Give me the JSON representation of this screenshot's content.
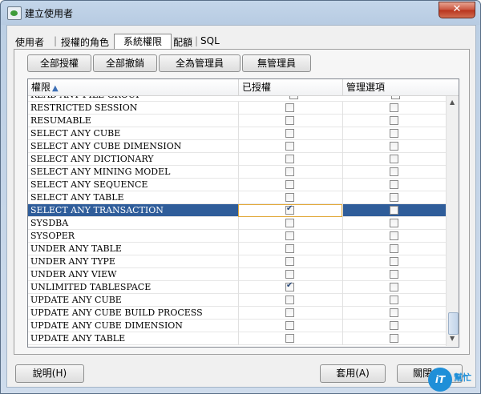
{
  "window": {
    "title": "建立使用者",
    "close_glyph": "✕"
  },
  "tabs": [
    {
      "label": "使用者"
    },
    {
      "label": "授權的角色"
    },
    {
      "label": "系統權限"
    },
    {
      "label": "配額"
    },
    {
      "label": "SQL"
    }
  ],
  "toolbar": {
    "grant_all": "全部授權",
    "revoke_all": "全部撤銷",
    "all_admin": "全為管理員",
    "no_admin": "無管理員"
  },
  "table": {
    "columns": [
      "權限",
      "已授權",
      "管理選項"
    ],
    "sort_icon": "sort-ascending-icon",
    "partial_row_label": "READ ANY FILE GROUP",
    "rows": [
      {
        "name": "RESTRICTED SESSION",
        "granted": false,
        "admin": false
      },
      {
        "name": "RESUMABLE",
        "granted": false,
        "admin": false
      },
      {
        "name": "SELECT ANY CUBE",
        "granted": false,
        "admin": false
      },
      {
        "name": "SELECT ANY CUBE DIMENSION",
        "granted": false,
        "admin": false
      },
      {
        "name": "SELECT ANY DICTIONARY",
        "granted": false,
        "admin": false
      },
      {
        "name": "SELECT ANY MINING MODEL",
        "granted": false,
        "admin": false
      },
      {
        "name": "SELECT ANY SEQUENCE",
        "granted": false,
        "admin": false
      },
      {
        "name": "SELECT ANY TABLE",
        "granted": false,
        "admin": false
      },
      {
        "name": "SELECT ANY TRANSACTION",
        "granted": true,
        "admin": false,
        "selected": true
      },
      {
        "name": "SYSDBA",
        "granted": false,
        "admin": false
      },
      {
        "name": "SYSOPER",
        "granted": false,
        "admin": false
      },
      {
        "name": "UNDER ANY TABLE",
        "granted": false,
        "admin": false
      },
      {
        "name": "UNDER ANY TYPE",
        "granted": false,
        "admin": false
      },
      {
        "name": "UNDER ANY VIEW",
        "granted": false,
        "admin": false
      },
      {
        "name": "UNLIMITED TABLESPACE",
        "granted": true,
        "admin": false
      },
      {
        "name": "UPDATE ANY CUBE",
        "granted": false,
        "admin": false
      },
      {
        "name": "UPDATE ANY CUBE BUILD PROCESS",
        "granted": false,
        "admin": false
      },
      {
        "name": "UPDATE ANY CUBE DIMENSION",
        "granted": false,
        "admin": false
      },
      {
        "name": "UPDATE ANY TABLE",
        "granted": false,
        "admin": false
      }
    ]
  },
  "footer": {
    "help": "說明(H)",
    "apply": "套用(A)",
    "close": "關閉(C)"
  },
  "watermark": {
    "logo": "iT",
    "text": "幫忙"
  },
  "colors": {
    "selection": "#2f5d9a",
    "focus_border": "#e2a93a"
  }
}
